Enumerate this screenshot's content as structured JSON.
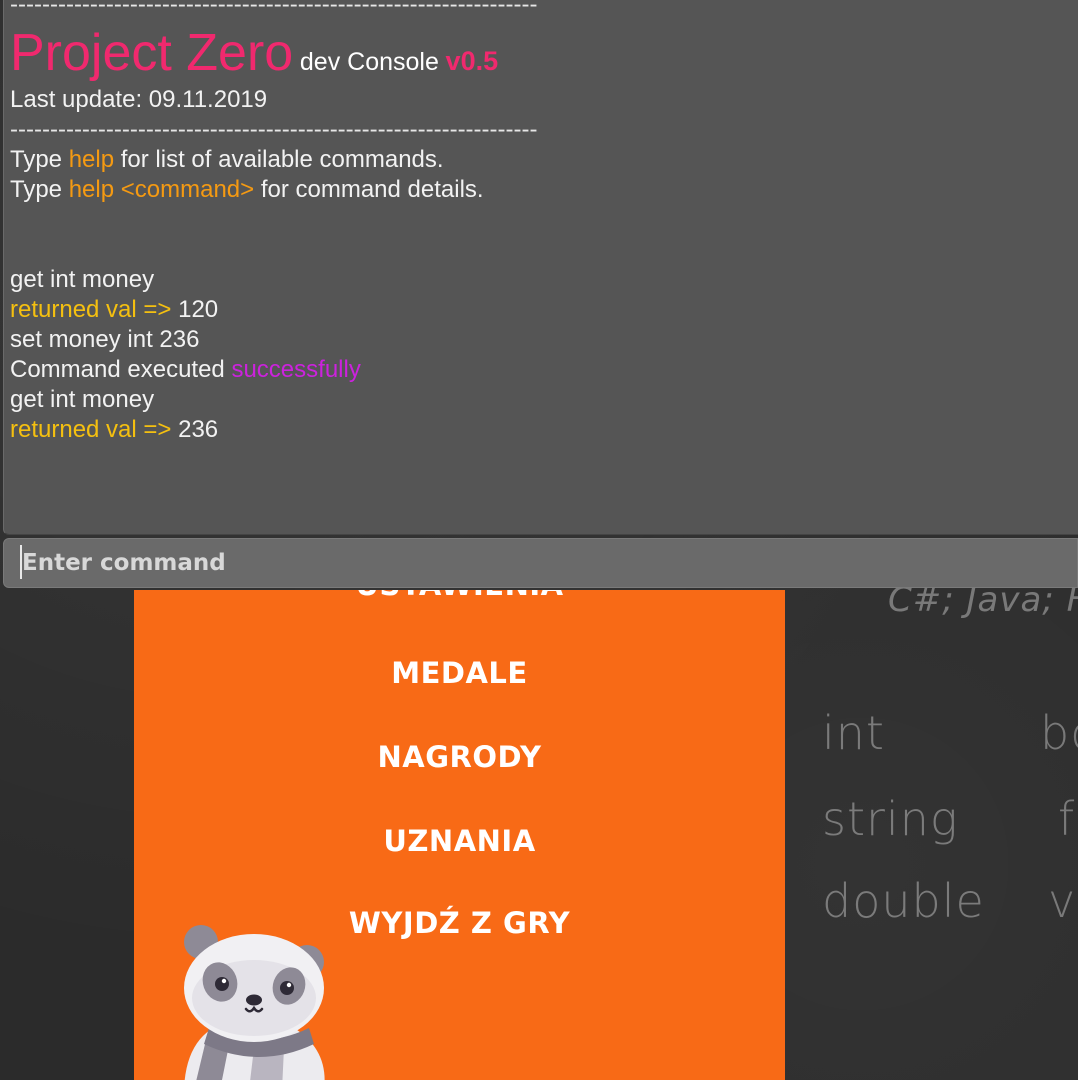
{
  "console": {
    "separator": "------------------------------------------------------------------",
    "title": "Project Zero",
    "subtitle": "dev Console",
    "version": "v0.5",
    "last_update": "Last update: 09.11.2019",
    "help_lines": [
      {
        "prefix": "Type ",
        "keyword": "help",
        "suffix": " for list of available commands."
      },
      {
        "prefix": "Type ",
        "keyword": "help <command>",
        "suffix": " for command details."
      }
    ],
    "log": [
      {
        "text": "get int money"
      },
      {
        "label": "returned val => ",
        "value": "120"
      },
      {
        "text": "set money int 236"
      },
      {
        "prefix": "Command executed ",
        "status": "successfully"
      },
      {
        "text": "get int money"
      },
      {
        "label": "returned val => ",
        "value": "236"
      }
    ],
    "input_placeholder": "Enter command",
    "colors": {
      "title": "#f0296e",
      "keyword": "#f59a12",
      "returned": "#f5c010",
      "success": "#cc22dd"
    }
  },
  "game_menu": {
    "partial_top_item": "USTAWIENIA",
    "items": [
      "MEDALE",
      "NAGRODY",
      "UZNANIA",
      "WYJDŹ Z GRY"
    ],
    "panel_color": "#f86a16"
  },
  "chalkboard": {
    "words": [
      "C#; Java; H",
      "int",
      "bo",
      "string",
      "f",
      "double",
      "v"
    ]
  }
}
